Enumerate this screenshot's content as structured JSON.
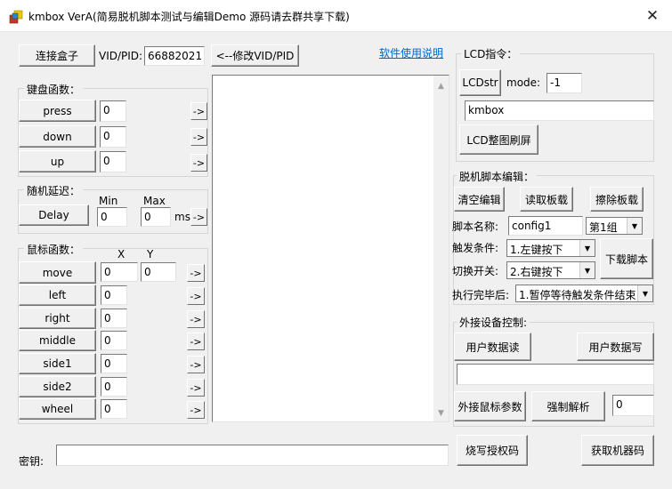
{
  "window": {
    "title": "kmbox VerA(简易脱机脚本测试与编辑Demo 源码请去群共享下载)"
  },
  "top": {
    "connect_label": "连接盒子",
    "vidpid_label": "VID/PID:",
    "vidpid_value": "66882021",
    "modify_vidpid_label": "<--修改VID/PID",
    "help_link": "软件使用说明"
  },
  "keyboard": {
    "title": "键盘函数：",
    "rows": [
      {
        "label": "press",
        "value": "0",
        "arrow": "->"
      },
      {
        "label": "down",
        "value": "0",
        "arrow": "->"
      },
      {
        "label": "up",
        "value": "0",
        "arrow": "->"
      }
    ]
  },
  "delay": {
    "title": "随机延迟：",
    "min_label": "Min",
    "max_label": "Max",
    "button": "Delay",
    "min_value": "0",
    "max_value": "0",
    "unit": "ms",
    "arrow": "->"
  },
  "mouse": {
    "title": "鼠标函数：",
    "x_label": "X",
    "y_label": "Y",
    "move": {
      "label": "move",
      "x": "0",
      "y": "0",
      "arrow": "->"
    },
    "rows": [
      {
        "label": "left",
        "value": "0",
        "arrow": "->"
      },
      {
        "label": "right",
        "value": "0",
        "arrow": "->"
      },
      {
        "label": "middle",
        "value": "0",
        "arrow": "->"
      },
      {
        "label": "side1",
        "value": "0",
        "arrow": "->"
      },
      {
        "label": "side2",
        "value": "0",
        "arrow": "->"
      },
      {
        "label": "wheel",
        "value": "0",
        "arrow": "->"
      }
    ]
  },
  "lcd": {
    "title": "LCD指令：",
    "lcdstr_label": "LCDstr",
    "mode_label": "mode:",
    "mode_value": "-1",
    "text_value": "kmbox",
    "refresh_label": "LCD整图刷屏"
  },
  "script": {
    "title": "脱机脚本编辑：",
    "clear_label": "清空编辑",
    "read_label": "读取板载",
    "erase_label": "擦除板载",
    "name_label": "脚本名称:",
    "name_value": "config1",
    "group_value": "第1组",
    "trigger_label": "触发条件:",
    "trigger_value": "1.左键按下",
    "switch_label": "切换开关:",
    "switch_value": "2.右键按下",
    "download_label": "下载脚本",
    "after_label": "执行完毕后:",
    "after_value": "1.暂停等待触发条件结束"
  },
  "external": {
    "title": "外接设备控制:",
    "read_label": "用户数据读",
    "write_label": "用户数据写",
    "data_value": "",
    "mouse_param_label": "外接鼠标参数",
    "force_parse_label": "强制解析",
    "parse_value": "0"
  },
  "bottom": {
    "key_label": "密钥:",
    "key_value": "",
    "burn_label": "烧写授权码",
    "get_code_label": "获取机器码"
  }
}
